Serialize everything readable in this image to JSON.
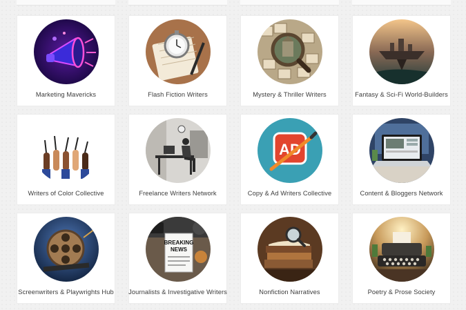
{
  "groups": [
    {
      "label": "Marketing Mavericks",
      "icon": "megaphone-icon"
    },
    {
      "label": "Flash Fiction Writers",
      "icon": "stopwatch-notebook-icon"
    },
    {
      "label": "Mystery & Thriller Writers",
      "icon": "magnifying-glass-icon"
    },
    {
      "label": "Fantasy & Sci-Fi World-Builders",
      "icon": "floating-city-icon"
    },
    {
      "label": "Writers of Color Collective",
      "icon": "raised-pens-icon"
    },
    {
      "label": "Freelance Writers Network",
      "icon": "desk-writer-icon"
    },
    {
      "label": "Copy & Ad Writers Collective",
      "icon": "ad-badge-icon",
      "badge_text": "AD"
    },
    {
      "label": "Content & Bloggers Network",
      "icon": "laptop-icon"
    },
    {
      "label": "Screenwriters & Playwrights Hub",
      "icon": "film-reel-icon"
    },
    {
      "label": "Journalists & Investigative Writers",
      "icon": "breaking-news-icon",
      "sign_line1": "BREAKING",
      "sign_line2": "NEWS"
    },
    {
      "label": "Nonfiction Narratives",
      "icon": "books-magnifier-icon"
    },
    {
      "label": "Poetry & Prose Society",
      "icon": "typewriter-icon"
    }
  ]
}
